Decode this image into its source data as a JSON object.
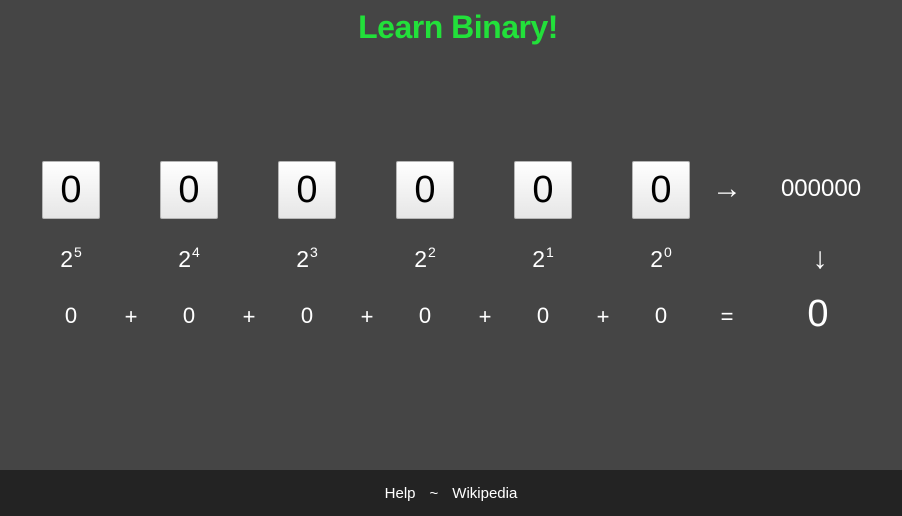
{
  "title": "Learn Binary!",
  "bits": [
    {
      "value": "0",
      "base": "2",
      "exp": "5",
      "term": "0"
    },
    {
      "value": "0",
      "base": "2",
      "exp": "4",
      "term": "0"
    },
    {
      "value": "0",
      "base": "2",
      "exp": "3",
      "term": "0"
    },
    {
      "value": "0",
      "base": "2",
      "exp": "2",
      "term": "0"
    },
    {
      "value": "0",
      "base": "2",
      "exp": "1",
      "term": "0"
    },
    {
      "value": "0",
      "base": "2",
      "exp": "0",
      "term": "0"
    }
  ],
  "operators": {
    "plus": "+",
    "equals": "="
  },
  "arrows": {
    "right": "→",
    "down": "↓"
  },
  "binary_string": "000000",
  "decimal_total": "0",
  "footer": {
    "help": "Help",
    "separator": "~",
    "wikipedia": "Wikipedia"
  },
  "colors": {
    "title": "#22e03a",
    "background": "#454545",
    "footer": "#232323"
  }
}
